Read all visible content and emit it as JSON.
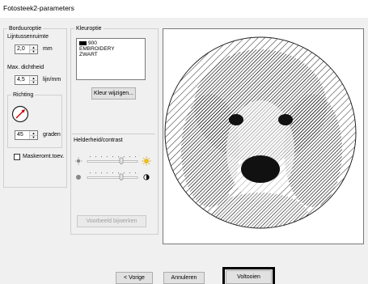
{
  "window": {
    "title": "Fotosteek2-parameters"
  },
  "borduuroptie": {
    "legend": "Borduuroptie",
    "line_spacing_label": "Lijntussenruimte",
    "line_spacing_value": "2,0",
    "line_spacing_unit": "mm",
    "max_density_label": "Max. dichtheid",
    "max_density_value": "4,5",
    "max_density_unit": "lijn/mm",
    "direction_label": "Richting",
    "direction_value": "45",
    "direction_unit": "graden",
    "mask_label": "Maskeromt.toev.",
    "mask_checked": false
  },
  "kleuroptie": {
    "legend": "Kleuroptie",
    "color_list": [
      {
        "text": "900",
        "swatch": "#000000"
      },
      {
        "text": "EMBROIDERY"
      },
      {
        "text": "ZWART"
      }
    ],
    "change_color_button": "Kleur wijzigen...",
    "brightness_label": "Helderheid/contrast",
    "brightness_level": 0.68,
    "contrast_level": 0.68,
    "update_preview_button": "Voorbeeld bijwerken"
  },
  "footer": {
    "back_button": "< Vorige",
    "cancel_button": "Annuleren",
    "finish_button": "Voltooien"
  },
  "colors": {
    "dialog_bg": "#f0f0f0",
    "direction_arrow": "#cc0000"
  }
}
